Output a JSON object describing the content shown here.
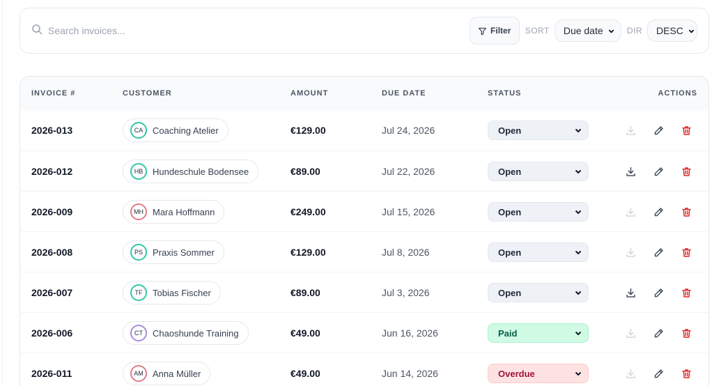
{
  "toolbar": {
    "search_placeholder": "Search invoices...",
    "filter_label": "Filter",
    "sort_label": "SORT",
    "sort_value": "Due date",
    "dir_label": "DIR",
    "dir_value": "DESC"
  },
  "table": {
    "headers": {
      "invoice": "INVOICE #",
      "customer": "CUSTOMER",
      "amount": "AMOUNT",
      "due_date": "DUE DATE",
      "status": "STATUS",
      "actions": "ACTIONS"
    },
    "rows": [
      {
        "invoice": "2026-013",
        "initials": "CA",
        "customer": "Coaching Atelier",
        "avatar_color": "#34c7a2",
        "amount": "€129.00",
        "due": "Jul 24, 2026",
        "status": "Open",
        "download_enabled": false
      },
      {
        "invoice": "2026-012",
        "initials": "HB",
        "customer": "Hundeschule Bodensee",
        "avatar_color": "#34c7a2",
        "amount": "€89.00",
        "due": "Jul 22, 2026",
        "status": "Open",
        "download_enabled": true
      },
      {
        "invoice": "2026-009",
        "initials": "MH",
        "customer": "Mara Hoffmann",
        "avatar_color": "#e07a86",
        "amount": "€249.00",
        "due": "Jul 15, 2026",
        "status": "Open",
        "download_enabled": false
      },
      {
        "invoice": "2026-008",
        "initials": "PS",
        "customer": "Praxis Sommer",
        "avatar_color": "#34c7a2",
        "amount": "€129.00",
        "due": "Jul 8, 2026",
        "status": "Open",
        "download_enabled": false
      },
      {
        "invoice": "2026-007",
        "initials": "TF",
        "customer": "Tobias Fischer",
        "avatar_color": "#34c7a2",
        "amount": "€89.00",
        "due": "Jul 3, 2026",
        "status": "Open",
        "download_enabled": true
      },
      {
        "invoice": "2026-006",
        "initials": "CT",
        "customer": "Chaoshunde Training",
        "avatar_color": "#a78bda",
        "amount": "€49.00",
        "due": "Jun 16, 2026",
        "status": "Paid",
        "download_enabled": false
      },
      {
        "invoice": "2026-011",
        "initials": "AM",
        "customer": "Anna Müller",
        "avatar_color": "#e07a86",
        "amount": "€49.00",
        "due": "Jun 14, 2026",
        "status": "Overdue",
        "download_enabled": false
      }
    ]
  },
  "status_styles": {
    "Open": {
      "bg": "#eef2f7",
      "border": "#e2e8f0",
      "color": "#1f2937"
    },
    "Paid": {
      "bg": "#d1fae5",
      "border": "#a7f3d0",
      "color": "#065f46"
    },
    "Overdue": {
      "bg": "#fee2e2",
      "border": "#fecaca",
      "color": "#9f1239"
    }
  },
  "colors": {
    "delete": "#dc2626",
    "icon": "#374151",
    "icon_disabled": "#d1d5db"
  },
  "icons": {
    "search": "search-icon",
    "filter": "filter-icon",
    "download": "download-icon",
    "edit": "pencil-icon",
    "delete": "trash-icon",
    "chevron": "chevron-down-icon"
  }
}
